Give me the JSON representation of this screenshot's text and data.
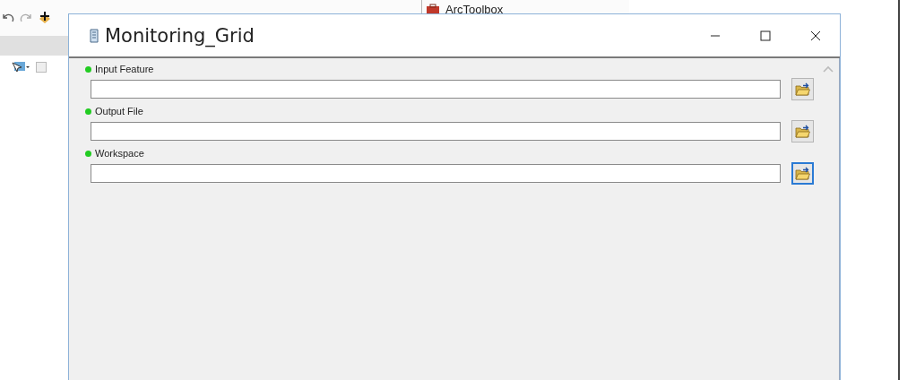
{
  "background_app": {
    "toolbar_title": "ArcToolbox"
  },
  "window": {
    "title": "Monitoring_Grid"
  },
  "parameters": [
    {
      "label": "Input Feature",
      "required": true,
      "browse_focused": false
    },
    {
      "label": "Output File",
      "required": true,
      "browse_focused": false
    },
    {
      "label": "Workspace",
      "required": true,
      "browse_focused": true
    }
  ]
}
